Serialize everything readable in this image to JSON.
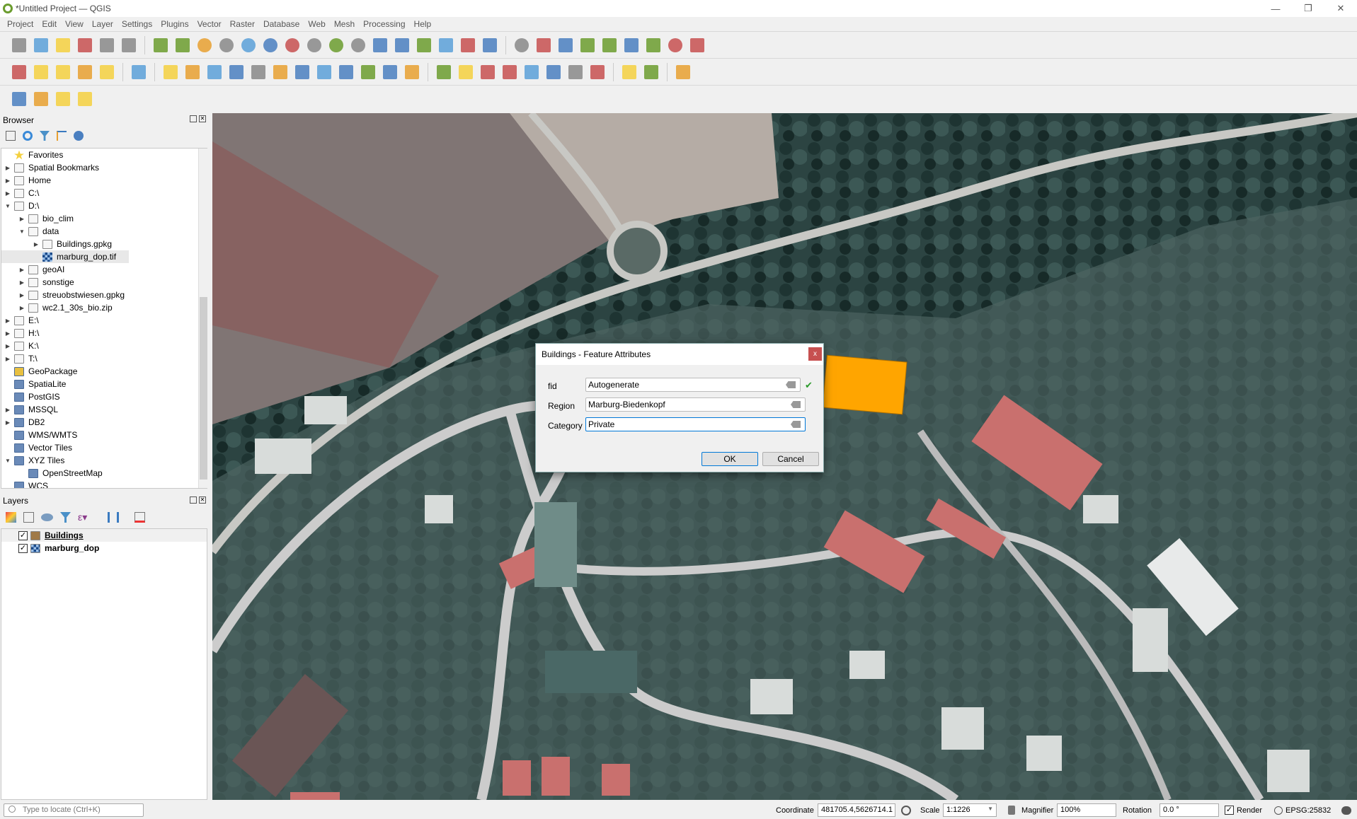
{
  "window": {
    "title": "*Untitled Project — QGIS",
    "controls": [
      "—",
      "❐",
      "✕"
    ]
  },
  "menu": [
    "Project",
    "Edit",
    "View",
    "Layer",
    "Settings",
    "Plugins",
    "Vector",
    "Raster",
    "Database",
    "Web",
    "Mesh",
    "Processing",
    "Help"
  ],
  "toolbars": [
    [
      "new-project",
      "open-project",
      "save-project",
      "new-print-layout",
      "layout-manager",
      "style-manager",
      "|",
      "pan",
      "pan-to-selection",
      "zoom-in",
      "zoom-out",
      "zoom-full",
      "zoom-to-selection",
      "zoom-to-layer",
      "zoom-native",
      "zoom-last",
      "zoom-next",
      "new-map-view",
      "new-3d-view",
      "new-bookmark",
      "show-bookmarks",
      "temporal-controller",
      "refresh",
      "|",
      "identify",
      "attribute-table",
      "statistics",
      "processing-toolbox",
      "sum",
      "measure",
      "map-tips",
      "zoom-tool",
      "text-annotation"
    ],
    [
      "data-source-manager",
      "new-geopackage-layer",
      "new-shapefile-layer",
      "new-spatialite-layer",
      "new-virtual-layer",
      "|",
      "new-mesh-layer",
      "|",
      "current-edits",
      "toggle-editing",
      "save-edits",
      "add-polygon",
      "digitize-tool",
      "modify-attributes",
      "delete-selected",
      "cut-features",
      "copy-features",
      "paste-features",
      "undo",
      "redo",
      "|",
      "label-tool",
      "layer-diagram",
      "pin-labels",
      "highlight-labels",
      "show-hide-labels",
      "move-label",
      "rotate-label",
      "change-label",
      "|",
      "plugin-globe",
      "python-console",
      "|",
      "help"
    ],
    [
      "select-features",
      "select-by-value",
      "deselect-all",
      "select-by-location"
    ]
  ],
  "browser": {
    "title": "Browser",
    "items": [
      {
        "label": "Favorites",
        "depth": 0,
        "arrow": "",
        "icon": "star-icon"
      },
      {
        "label": "Spatial Bookmarks",
        "depth": 0,
        "arrow": "▶",
        "icon": "bookmark-icon"
      },
      {
        "label": "Home",
        "depth": 0,
        "arrow": "▶",
        "icon": "home-folder-icon"
      },
      {
        "label": "C:\\",
        "depth": 0,
        "arrow": "▶",
        "icon": "folder-icon"
      },
      {
        "label": "D:\\",
        "depth": 0,
        "arrow": "▼",
        "icon": "folder-open-icon"
      },
      {
        "label": "bio_clim",
        "depth": 1,
        "arrow": "▶",
        "icon": "folder-icon"
      },
      {
        "label": "data",
        "depth": 1,
        "arrow": "▼",
        "icon": "folder-open-icon"
      },
      {
        "label": "Buildings.gpkg",
        "depth": 2,
        "arrow": "▶",
        "icon": "database-icon"
      },
      {
        "label": "marburg_dop.tif",
        "depth": 2,
        "arrow": "",
        "icon": "raster-icon",
        "selected": true
      },
      {
        "label": "geoAI",
        "depth": 1,
        "arrow": "▶",
        "icon": "folder-icon"
      },
      {
        "label": "sonstige",
        "depth": 1,
        "arrow": "▶",
        "icon": "folder-icon"
      },
      {
        "label": "streuobstwiesen.gpkg",
        "depth": 1,
        "arrow": "▶",
        "icon": "database-icon"
      },
      {
        "label": "wc2.1_30s_bio.zip",
        "depth": 1,
        "arrow": "▶",
        "icon": "zip-icon"
      },
      {
        "label": "E:\\",
        "depth": 0,
        "arrow": "▶",
        "icon": "folder-icon"
      },
      {
        "label": "H:\\",
        "depth": 0,
        "arrow": "▶",
        "icon": "folder-icon"
      },
      {
        "label": "K:\\",
        "depth": 0,
        "arrow": "▶",
        "icon": "folder-icon"
      },
      {
        "label": "T:\\",
        "depth": 0,
        "arrow": "▶",
        "icon": "folder-icon"
      },
      {
        "label": "GeoPackage",
        "depth": 0,
        "arrow": "",
        "icon": "geopackage-icon"
      },
      {
        "label": "SpatiaLite",
        "depth": 0,
        "arrow": "",
        "icon": "spatialite-icon"
      },
      {
        "label": "PostGIS",
        "depth": 0,
        "arrow": "",
        "icon": "postgis-icon"
      },
      {
        "label": "MSSQL",
        "depth": 0,
        "arrow": "▶",
        "icon": "mssql-icon"
      },
      {
        "label": "DB2",
        "depth": 0,
        "arrow": "▶",
        "icon": "db2-icon"
      },
      {
        "label": "WMS/WMTS",
        "depth": 0,
        "arrow": "",
        "icon": "globe-icon"
      },
      {
        "label": "Vector Tiles",
        "depth": 0,
        "arrow": "",
        "icon": "grid-icon"
      },
      {
        "label": "XYZ Tiles",
        "depth": 0,
        "arrow": "▼",
        "icon": "grid-icon"
      },
      {
        "label": "OpenStreetMap",
        "depth": 1,
        "arrow": "",
        "icon": "grid-icon"
      },
      {
        "label": "WCS",
        "depth": 0,
        "arrow": "",
        "icon": "globe-icon"
      }
    ]
  },
  "layers": {
    "title": "Layers",
    "items": [
      {
        "label": "Buildings",
        "checked": true,
        "icon": "polygon-layer-icon",
        "active": true
      },
      {
        "label": "marburg_dop",
        "checked": true,
        "icon": "raster-icon"
      }
    ]
  },
  "dialog": {
    "title": "Buildings - Feature Attributes",
    "close": "x",
    "fields": [
      {
        "label": "fid",
        "value": "Autogenerate",
        "valid": "✔"
      },
      {
        "label": "Region",
        "value": "Marburg-Biedenkopf"
      },
      {
        "label": "Category",
        "value": "Private"
      }
    ],
    "ok": "OK",
    "cancel": "Cancel"
  },
  "status": {
    "locate_placeholder": "Type to locate (Ctrl+K)",
    "coordinate_label": "Coordinate",
    "coordinate": "481705.4,5626714.1",
    "scale_label": "Scale",
    "scale": "1:1226",
    "magnifier_label": "Magnifier",
    "magnifier": "100%",
    "rotation_label": "Rotation",
    "rotation": "0.0 °",
    "render_label": "Render",
    "render_checked": true,
    "crs": "EPSG:25832"
  },
  "colors": {
    "selected_feature": "#ffa500",
    "dialog_close": "#c75050",
    "accent": "#0078d7"
  }
}
